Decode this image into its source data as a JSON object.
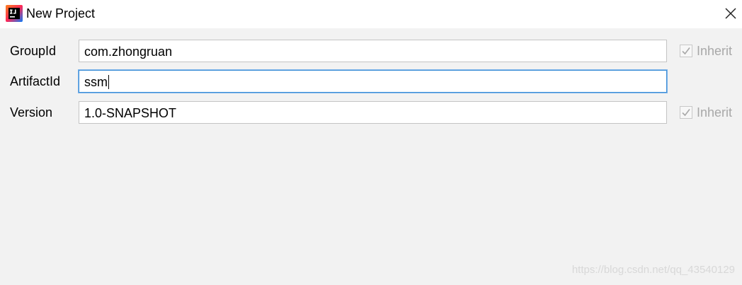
{
  "window": {
    "title": "New Project",
    "app_icon": "intellij-idea-icon",
    "close_icon": "close-icon"
  },
  "form": {
    "group_id": {
      "label": "GroupId",
      "value": "com.zhongruan",
      "inherit_label": "Inherit",
      "inherit_checked": true
    },
    "artifact_id": {
      "label": "ArtifactId",
      "value": "ssm",
      "focused": true
    },
    "version": {
      "label": "Version",
      "value": "1.0-SNAPSHOT",
      "inherit_label": "Inherit",
      "inherit_checked": true
    }
  },
  "watermark": "https://blog.csdn.net/qq_43540129",
  "colors": {
    "background": "#f2f2f2",
    "titlebar": "#ffffff",
    "focus_border": "#3d8fd6",
    "disabled_text": "#a8a8a8"
  }
}
